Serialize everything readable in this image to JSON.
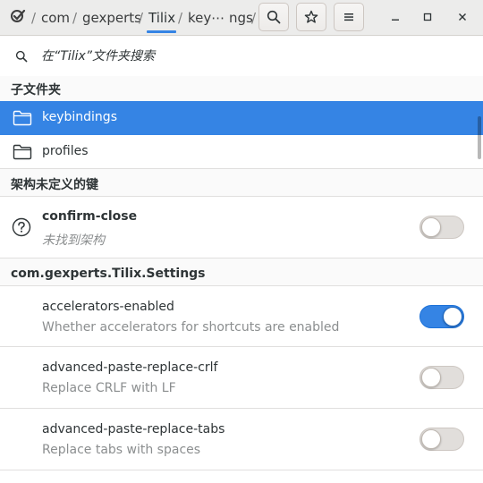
{
  "header": {
    "breadcrumbs": [
      "com",
      "gexperts",
      "Tilix",
      "key⋯ ngs"
    ],
    "separator": "/",
    "active_crumb": "Tilix"
  },
  "search": {
    "placeholder": "在“Tilix”文件夹搜索"
  },
  "sections": {
    "subfolders": "子文件夹",
    "undefined_schema": "架构未定义的键",
    "settings": "com.gexperts.Tilix.Settings"
  },
  "folders": [
    {
      "label": "keybindings",
      "selected": true
    },
    {
      "label": "profiles",
      "selected": false
    }
  ],
  "undefined_keys": [
    {
      "label": "confirm-close",
      "subtitle": "未找到架构",
      "value": false
    }
  ],
  "settings": [
    {
      "label": "accelerators-enabled",
      "subtitle": "Whether accelerators for shortcuts are enabled",
      "value": true
    },
    {
      "label": "advanced-paste-replace-crlf",
      "subtitle": "Replace CRLF with LF",
      "value": false
    },
    {
      "label": "advanced-paste-replace-tabs",
      "subtitle": "Replace tabs with spaces",
      "value": false
    }
  ],
  "colors": {
    "accent": "#3584e4",
    "header_bg": "#ececeb",
    "subtitle": "#8b8e8f"
  },
  "icons": {
    "app": "dconf-editor-icon",
    "search": "search-icon",
    "bookmark": "star-icon",
    "menu": "hamburger-menu-icon",
    "minimize": "minimize-icon",
    "maximize": "maximize-icon",
    "close": "close-icon",
    "folder": "folder-icon",
    "unknown": "question-mark-icon"
  }
}
